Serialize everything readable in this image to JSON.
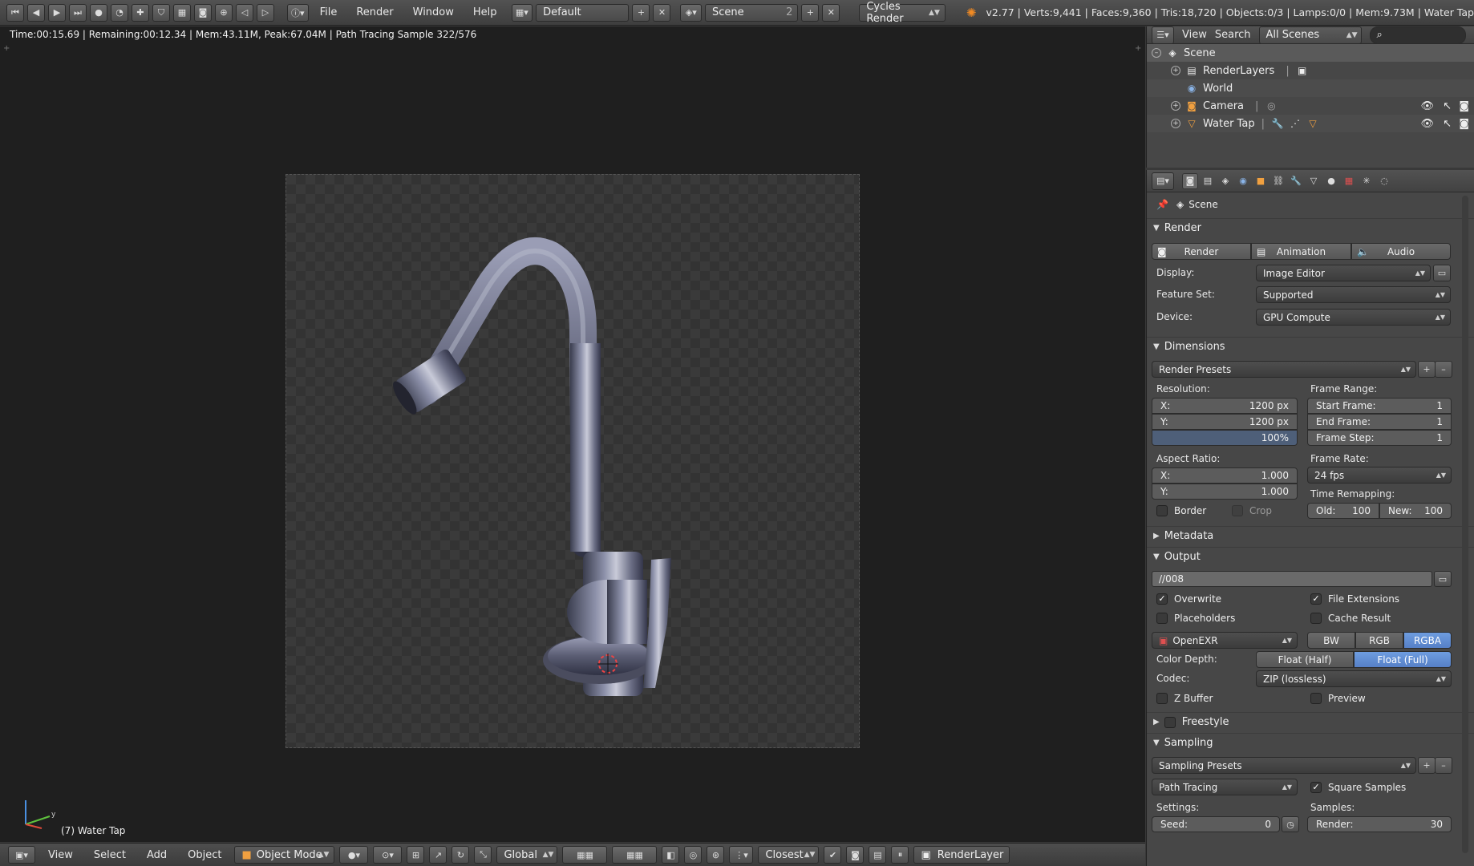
{
  "topbar": {
    "menus": [
      "File",
      "Render",
      "Window",
      "Help"
    ],
    "screen_layout": "Default",
    "scene": "Scene",
    "scene_users": "2",
    "render_engine": "Cycles Render",
    "stats": "v2.77 | Verts:9,441 | Faces:9,360 | Tris:18,720 | Objects:0/3 | Lamps:0/0 | Mem:9.73M | Water Tap"
  },
  "viewport": {
    "status": "Time:00:15.69 | Remaining:00:12.34 | Mem:43.11M, Peak:67.04M | Path Tracing Sample 322/576",
    "object_label": "(7) Water Tap"
  },
  "bottombar": {
    "view": "View",
    "select": "Select",
    "add": "Add",
    "object": "Object",
    "mode": "Object Mode",
    "orientation": "Global",
    "snap": "Closest",
    "render_layer": "RenderLayer"
  },
  "outliner": {
    "view": "View",
    "search": "Search",
    "filter": "All Scenes",
    "items": [
      {
        "label": "Scene"
      },
      {
        "label": "RenderLayers"
      },
      {
        "label": "World"
      },
      {
        "label": "Camera"
      },
      {
        "label": "Water Tap"
      }
    ]
  },
  "properties": {
    "context": "Scene",
    "render_panel": {
      "title": "Render",
      "buttons": [
        "Render",
        "Animation",
        "Audio"
      ],
      "display_label": "Display:",
      "display_value": "Image Editor",
      "feature_set_label": "Feature Set:",
      "feature_set_value": "Supported",
      "device_label": "Device:",
      "device_value": "GPU Compute"
    },
    "dimensions_panel": {
      "title": "Dimensions",
      "presets": "Render Presets",
      "resolution_label": "Resolution:",
      "res_x": "X:",
      "res_x_val": "1200 px",
      "res_y": "Y:",
      "res_y_val": "1200 px",
      "res_pct": "100%",
      "aspect_label": "Aspect Ratio:",
      "asp_x": "X:",
      "asp_x_val": "1.000",
      "asp_y": "Y:",
      "asp_y_val": "1.000",
      "border": "Border",
      "crop": "Crop",
      "frame_range_label": "Frame Range:",
      "start_frame": "Start Frame:",
      "start_frame_val": "1",
      "end_frame": "End Frame:",
      "end_frame_val": "1",
      "frame_step": "Frame Step:",
      "frame_step_val": "1",
      "frame_rate_label": "Frame Rate:",
      "frame_rate": "24 fps",
      "time_remap_label": "Time Remapping:",
      "old": "Old:",
      "old_val": "100",
      "new": "New:",
      "new_val": "100"
    },
    "metadata_panel": {
      "title": "Metadata"
    },
    "output_panel": {
      "title": "Output",
      "path": "//008",
      "overwrite": "Overwrite",
      "file_extensions": "File Extensions",
      "placeholders": "Placeholders",
      "cache_result": "Cache Result",
      "format": "OpenEXR",
      "color_modes": [
        "BW",
        "RGB",
        "RGBA"
      ],
      "color_depth_label": "Color Depth:",
      "color_depths": [
        "Float (Half)",
        "Float (Full)"
      ],
      "codec_label": "Codec:",
      "codec": "ZIP (lossless)",
      "z_buffer": "Z Buffer",
      "preview": "Preview"
    },
    "freestyle_panel": {
      "title": "Freestyle"
    },
    "sampling_panel": {
      "title": "Sampling",
      "presets": "Sampling Presets",
      "integrator": "Path Tracing",
      "square_samples": "Square Samples",
      "settings_label": "Settings:",
      "samples_label": "Samples:",
      "seed": "Seed:",
      "seed_val": "0",
      "render": "Render:",
      "render_val": "30"
    }
  }
}
